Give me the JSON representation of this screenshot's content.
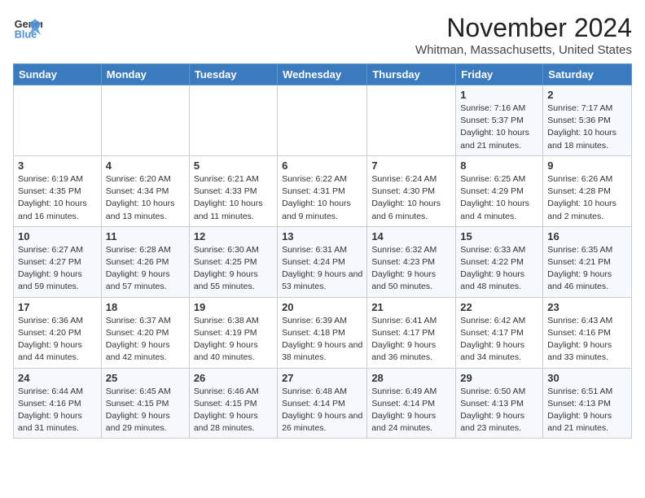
{
  "logo": {
    "line1": "General",
    "line2": "Blue"
  },
  "title": "November 2024",
  "subtitle": "Whitman, Massachusetts, United States",
  "days_of_week": [
    "Sunday",
    "Monday",
    "Tuesday",
    "Wednesday",
    "Thursday",
    "Friday",
    "Saturday"
  ],
  "weeks": [
    [
      {
        "day": "",
        "info": ""
      },
      {
        "day": "",
        "info": ""
      },
      {
        "day": "",
        "info": ""
      },
      {
        "day": "",
        "info": ""
      },
      {
        "day": "",
        "info": ""
      },
      {
        "day": "1",
        "info": "Sunrise: 7:16 AM\nSunset: 5:37 PM\nDaylight: 10 hours and 21 minutes."
      },
      {
        "day": "2",
        "info": "Sunrise: 7:17 AM\nSunset: 5:36 PM\nDaylight: 10 hours and 18 minutes."
      }
    ],
    [
      {
        "day": "3",
        "info": "Sunrise: 6:19 AM\nSunset: 4:35 PM\nDaylight: 10 hours and 16 minutes."
      },
      {
        "day": "4",
        "info": "Sunrise: 6:20 AM\nSunset: 4:34 PM\nDaylight: 10 hours and 13 minutes."
      },
      {
        "day": "5",
        "info": "Sunrise: 6:21 AM\nSunset: 4:33 PM\nDaylight: 10 hours and 11 minutes."
      },
      {
        "day": "6",
        "info": "Sunrise: 6:22 AM\nSunset: 4:31 PM\nDaylight: 10 hours and 9 minutes."
      },
      {
        "day": "7",
        "info": "Sunrise: 6:24 AM\nSunset: 4:30 PM\nDaylight: 10 hours and 6 minutes."
      },
      {
        "day": "8",
        "info": "Sunrise: 6:25 AM\nSunset: 4:29 PM\nDaylight: 10 hours and 4 minutes."
      },
      {
        "day": "9",
        "info": "Sunrise: 6:26 AM\nSunset: 4:28 PM\nDaylight: 10 hours and 2 minutes."
      }
    ],
    [
      {
        "day": "10",
        "info": "Sunrise: 6:27 AM\nSunset: 4:27 PM\nDaylight: 9 hours and 59 minutes."
      },
      {
        "day": "11",
        "info": "Sunrise: 6:28 AM\nSunset: 4:26 PM\nDaylight: 9 hours and 57 minutes."
      },
      {
        "day": "12",
        "info": "Sunrise: 6:30 AM\nSunset: 4:25 PM\nDaylight: 9 hours and 55 minutes."
      },
      {
        "day": "13",
        "info": "Sunrise: 6:31 AM\nSunset: 4:24 PM\nDaylight: 9 hours and 53 minutes."
      },
      {
        "day": "14",
        "info": "Sunrise: 6:32 AM\nSunset: 4:23 PM\nDaylight: 9 hours and 50 minutes."
      },
      {
        "day": "15",
        "info": "Sunrise: 6:33 AM\nSunset: 4:22 PM\nDaylight: 9 hours and 48 minutes."
      },
      {
        "day": "16",
        "info": "Sunrise: 6:35 AM\nSunset: 4:21 PM\nDaylight: 9 hours and 46 minutes."
      }
    ],
    [
      {
        "day": "17",
        "info": "Sunrise: 6:36 AM\nSunset: 4:20 PM\nDaylight: 9 hours and 44 minutes."
      },
      {
        "day": "18",
        "info": "Sunrise: 6:37 AM\nSunset: 4:20 PM\nDaylight: 9 hours and 42 minutes."
      },
      {
        "day": "19",
        "info": "Sunrise: 6:38 AM\nSunset: 4:19 PM\nDaylight: 9 hours and 40 minutes."
      },
      {
        "day": "20",
        "info": "Sunrise: 6:39 AM\nSunset: 4:18 PM\nDaylight: 9 hours and 38 minutes."
      },
      {
        "day": "21",
        "info": "Sunrise: 6:41 AM\nSunset: 4:17 PM\nDaylight: 9 hours and 36 minutes."
      },
      {
        "day": "22",
        "info": "Sunrise: 6:42 AM\nSunset: 4:17 PM\nDaylight: 9 hours and 34 minutes."
      },
      {
        "day": "23",
        "info": "Sunrise: 6:43 AM\nSunset: 4:16 PM\nDaylight: 9 hours and 33 minutes."
      }
    ],
    [
      {
        "day": "24",
        "info": "Sunrise: 6:44 AM\nSunset: 4:16 PM\nDaylight: 9 hours and 31 minutes."
      },
      {
        "day": "25",
        "info": "Sunrise: 6:45 AM\nSunset: 4:15 PM\nDaylight: 9 hours and 29 minutes."
      },
      {
        "day": "26",
        "info": "Sunrise: 6:46 AM\nSunset: 4:15 PM\nDaylight: 9 hours and 28 minutes."
      },
      {
        "day": "27",
        "info": "Sunrise: 6:48 AM\nSunset: 4:14 PM\nDaylight: 9 hours and 26 minutes."
      },
      {
        "day": "28",
        "info": "Sunrise: 6:49 AM\nSunset: 4:14 PM\nDaylight: 9 hours and 24 minutes."
      },
      {
        "day": "29",
        "info": "Sunrise: 6:50 AM\nSunset: 4:13 PM\nDaylight: 9 hours and 23 minutes."
      },
      {
        "day": "30",
        "info": "Sunrise: 6:51 AM\nSunset: 4:13 PM\nDaylight: 9 hours and 21 minutes."
      }
    ]
  ]
}
